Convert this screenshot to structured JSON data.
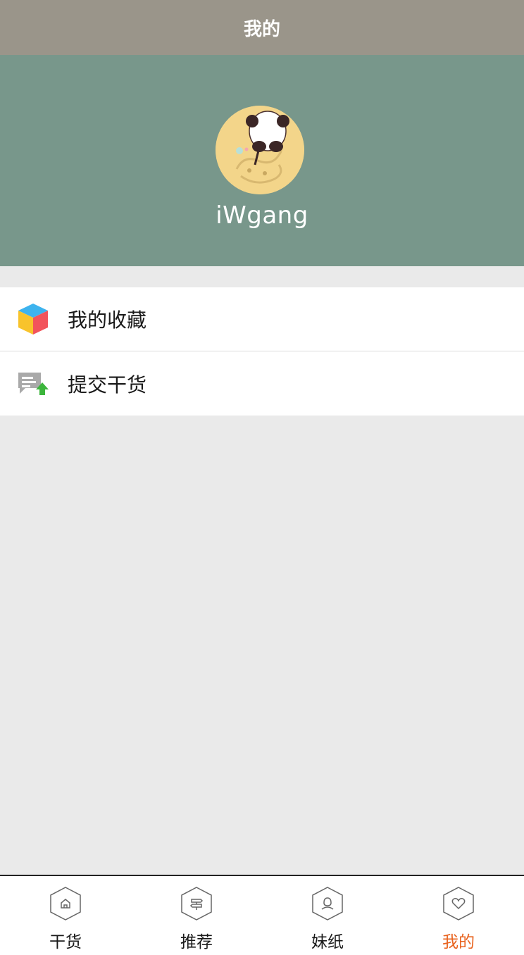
{
  "navbar": {
    "title": "我的"
  },
  "profile": {
    "username": "iWgang",
    "avatar_icon": "panda-avatar"
  },
  "menu": {
    "items": [
      {
        "label": "我的收藏",
        "icon": "cube-icon"
      },
      {
        "label": "提交干货",
        "icon": "comment-upload-icon"
      }
    ]
  },
  "tabbar": {
    "active_color": "#e8631f",
    "items": [
      {
        "label": "干货",
        "icon": "home-hexagon-icon",
        "active": false
      },
      {
        "label": "推荐",
        "icon": "signpost-hexagon-icon",
        "active": false
      },
      {
        "label": "妹纸",
        "icon": "person-hexagon-icon",
        "active": false
      },
      {
        "label": "我的",
        "icon": "heart-hexagon-icon",
        "active": true
      }
    ]
  },
  "colors": {
    "navbar_bg": "#9a958a",
    "profile_bg": "#78978b",
    "page_bg": "#eaeaea"
  }
}
